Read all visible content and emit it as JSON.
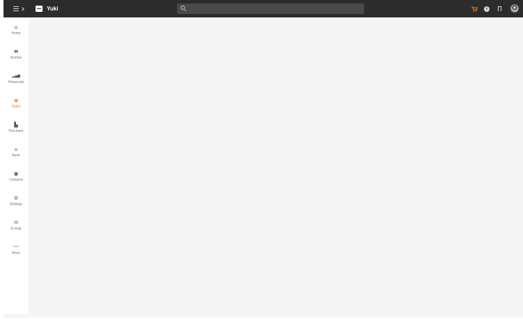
{
  "app": {
    "brand": "Yuki"
  },
  "topbar": {
    "search": {
      "placeholder": "",
      "value": ""
    },
    "icons": [
      "menu-icon",
      "chevron-right-icon",
      "logo-icon",
      "search-icon",
      "cart-icon",
      "info-icon",
      "bookmark-icon",
      "avatar"
    ],
    "cart_color": "#e8822a"
  },
  "sidebar": {
    "items": [
      {
        "label": "Home",
        "icon": "home-icon",
        "glyph": "⌂"
      },
      {
        "label": "Archive",
        "icon": "archive-icon",
        "glyph": "▮▮"
      },
      {
        "label": "Financials",
        "icon": "bar-chart-icon",
        "glyph": "▂▄▆"
      },
      {
        "label": "Sales",
        "icon": "sales-icon",
        "glyph": "◉",
        "active": true
      },
      {
        "label": "Purchase",
        "icon": "purchase-icon",
        "glyph": "▙"
      },
      {
        "label": "Bank",
        "icon": "bank-icon",
        "glyph": "⌂"
      },
      {
        "label": "Contacts",
        "icon": "contacts-icon",
        "glyph": "▣"
      },
      {
        "label": "Settings",
        "icon": "gear-icon",
        "glyph": "⚙"
      },
      {
        "label": "E-mail",
        "icon": "envelope-icon",
        "glyph": "✉"
      },
      {
        "label": "More",
        "icon": "ellipsis-icon",
        "glyph": "•••"
      }
    ]
  },
  "colors": {
    "accent": "#e8822a",
    "topbar": "#2c2c2c",
    "background": "#f5f5f5"
  }
}
